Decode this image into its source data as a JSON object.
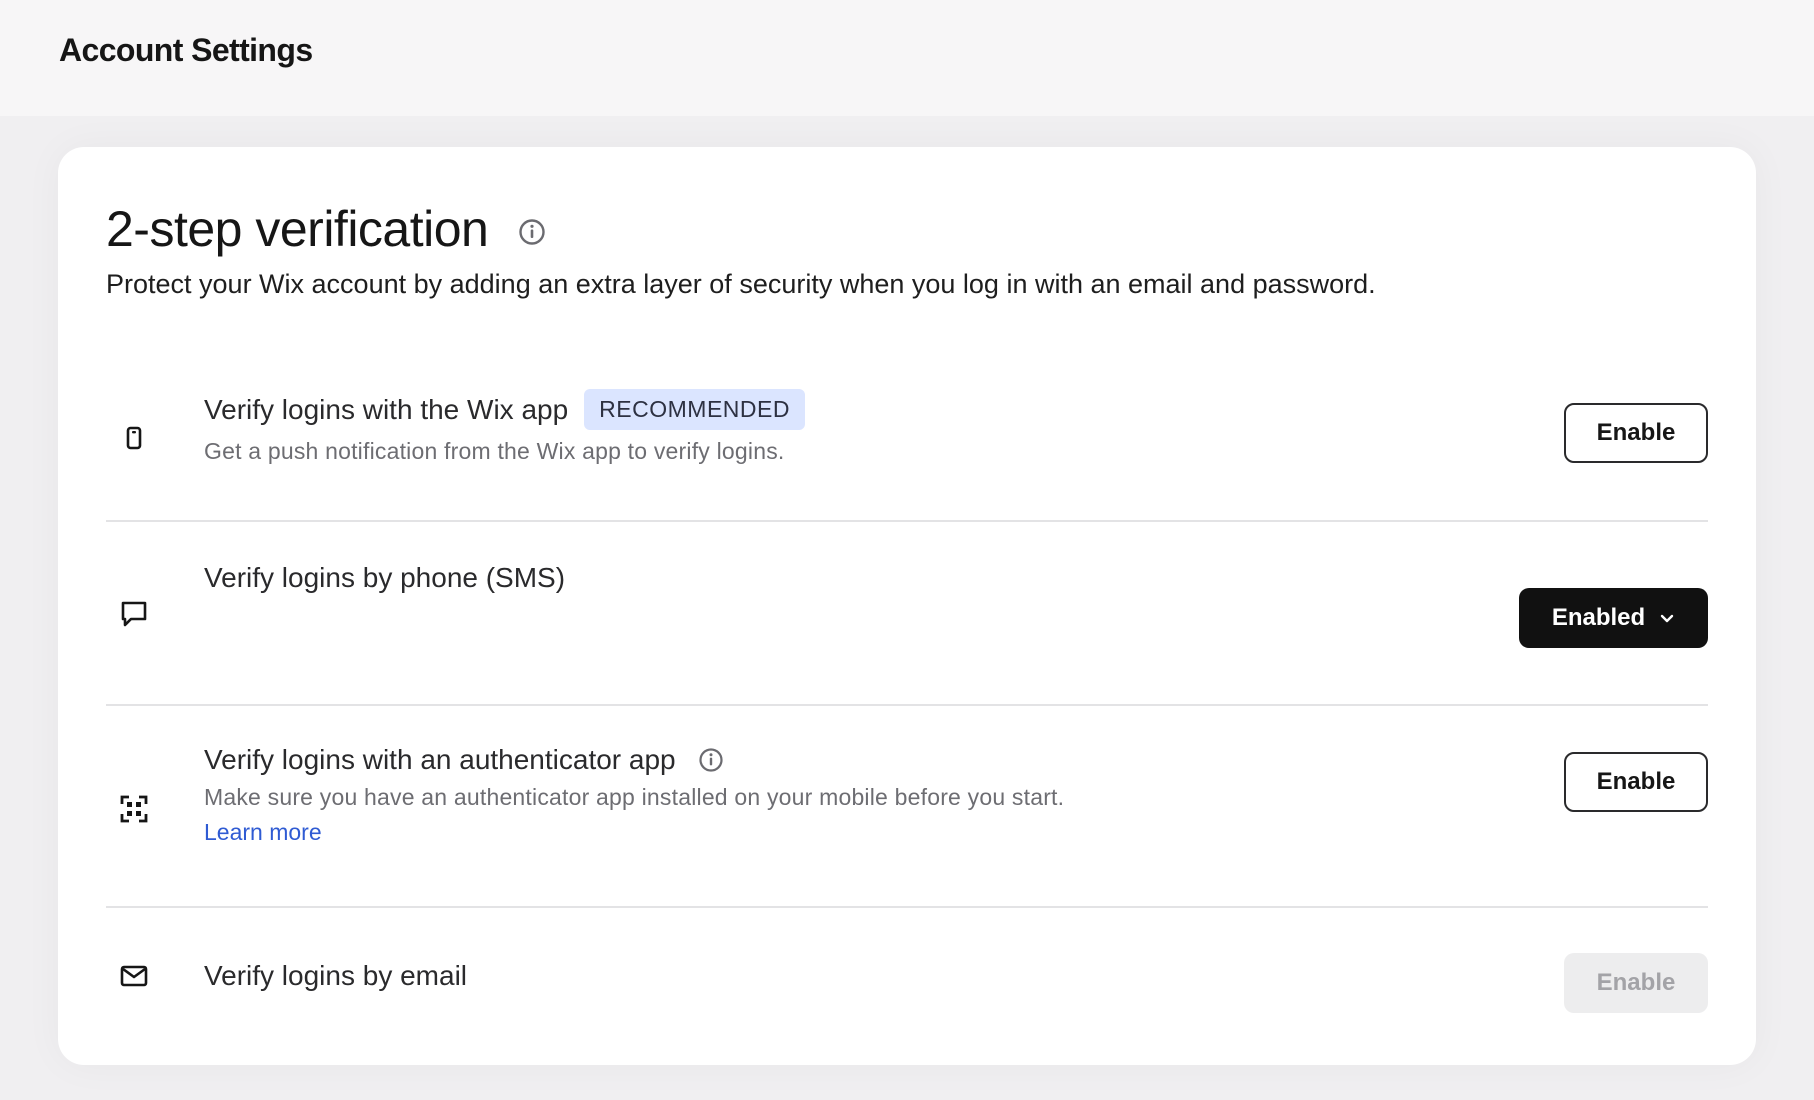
{
  "header": {
    "title": "Account Settings"
  },
  "section": {
    "title": "2-step verification",
    "info_icon": "info-icon",
    "subtitle": "Protect your Wix account by adding an extra layer of security when you log in with an email and password."
  },
  "options": [
    {
      "icon": "mobile-phone-icon",
      "title": "Verify logins with the Wix app",
      "badge": "RECOMMENDED",
      "description": "Get a push notification from the Wix app to verify logins.",
      "button": "Enable"
    },
    {
      "icon": "chat-bubble-icon",
      "title": "Verify logins by phone (SMS)",
      "button": "Enabled",
      "button_icon": "chevron-down-icon"
    },
    {
      "icon": "scan-qr-icon",
      "title": "Verify logins with an authenticator app",
      "title_icon": "info-icon",
      "description": "Make sure you have an authenticator app installed on your mobile before you start.",
      "link": "Learn more",
      "button": "Enable"
    },
    {
      "icon": "envelope-icon",
      "title": "Verify logins by email",
      "button": "Enable",
      "button_disabled": true
    }
  ],
  "colors": {
    "accent_link": "#2f5bd3",
    "badge_bg": "#dbe5ff",
    "dark_button": "#111111",
    "page_bg": "#f0eff1",
    "card_bg": "#ffffff"
  }
}
